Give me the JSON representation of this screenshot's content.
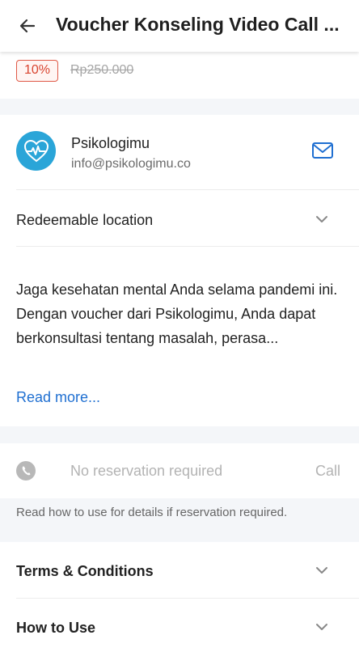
{
  "header": {
    "title": "Voucher Konseling Video Call ..."
  },
  "price": {
    "discount": "10%",
    "original_price": "Rp250.000"
  },
  "merchant": {
    "name": "Psikologimu",
    "email": "info@psikologimu.co"
  },
  "location": {
    "label": "Redeemable location"
  },
  "description": {
    "text": "Jaga kesehatan mental Anda selama pandemi ini. Dengan voucher dari Psikologimu, Anda dapat berkonsultasi tentang masalah, perasa...",
    "read_more": "Read more..."
  },
  "reservation": {
    "status": "No reservation required",
    "call_label": "Call",
    "note": "Read how to use for details if reservation required."
  },
  "sections": {
    "terms": "Terms & Conditions",
    "how_to_use": "How to Use"
  },
  "colors": {
    "accent": "#1f6fd1",
    "discount": "#d9442f",
    "avatar": "#2aa5d8"
  },
  "icons": [
    "back-arrow-icon",
    "heartbeat-icon",
    "mail-icon",
    "chevron-down-icon",
    "phone-icon"
  ]
}
